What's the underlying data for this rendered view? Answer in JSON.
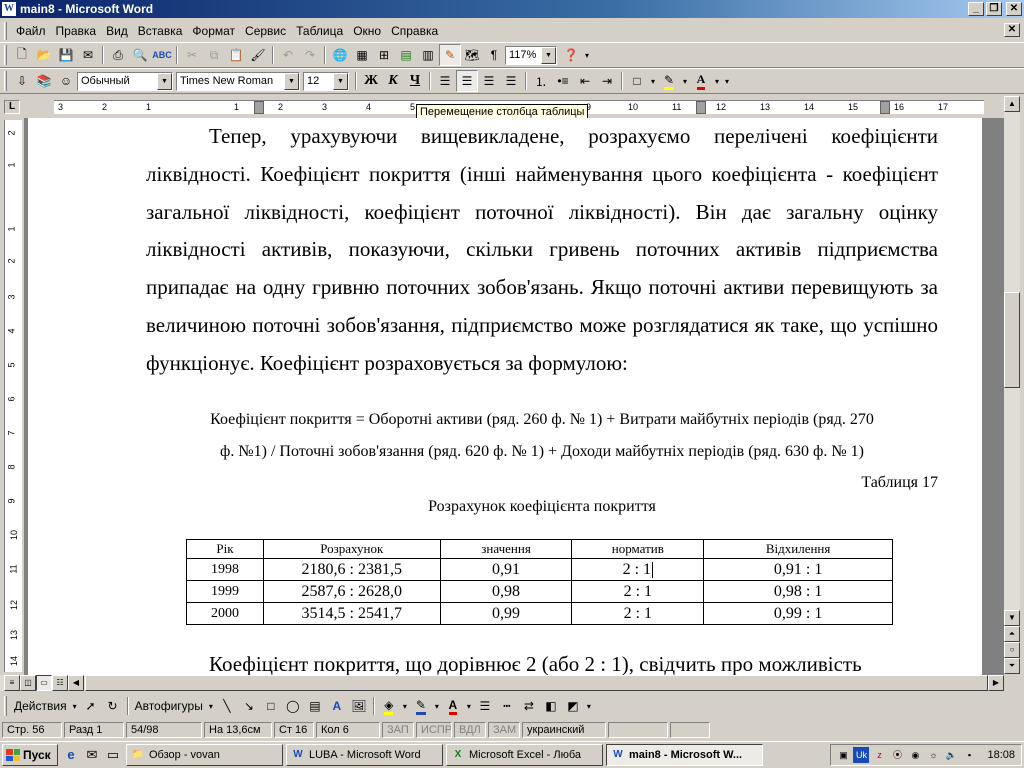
{
  "window": {
    "title": "main8 - Microsoft Word",
    "icon": "word-document-icon",
    "controls": [
      "minimize-icon",
      "restore-icon",
      "close-icon"
    ]
  },
  "menu": {
    "items": [
      "Файл",
      "Правка",
      "Вид",
      "Вставка",
      "Формат",
      "Сервис",
      "Таблица",
      "Окно",
      "Справка"
    ]
  },
  "toolbar_standard": {
    "zoom": "117%"
  },
  "toolbar_format": {
    "style": "Обычный",
    "font": "Times New Roman",
    "size": "12",
    "bold_label": "Ж",
    "italic_label": "К",
    "underline_label": "Ч"
  },
  "ruler": {
    "numbers": [
      "3",
      "2",
      "1",
      "1",
      "2",
      "3",
      "4",
      "5",
      "9",
      "10",
      "11",
      "12",
      "13",
      "14",
      "15",
      "16",
      "17"
    ],
    "vertical_numbers": [
      "2",
      "1",
      "1",
      "2",
      "3",
      "4",
      "5",
      "6",
      "7",
      "8",
      "9",
      "10",
      "11",
      "12",
      "13",
      "14"
    ]
  },
  "tooltip": "Перемещение столбца таблицы",
  "document": {
    "paragraph1": "Тепер, урахувуючи вищевикладене, розрахуємо перелічені коефіцієнти ліквідності. Коефіцієнт покриття (інші найменування цього коефіцієнта - коефіцієнт загальної ліквідності, коефіцієнт поточної ліквідності). Він дає загальну оцінку ліквідності активів, показуючи, скільки гривень поточних активів підприємства припадає на одну гривню поточних зобов'язань. Якщо поточні активи перевищують за величиною поточні зобов'язання, підприємство може розглядатися як таке, що успішно функціонує. Коефіцієнт розраховується за формулою:",
    "formula_line1": "Коефіцієнт покриття = Оборотні активи (ряд. 260 ф. № 1) + Витрати майбутніх періодів (ряд. 270",
    "formula_line2": "ф. №1) / Поточні зобов'язання (ряд. 620 ф. № 1) + Доходи майбутніх періодів (ряд. 630 ф. № 1)",
    "table_number": "Таблиця 17",
    "table_title": "Розрахунок коефіцієнта покриття",
    "table": {
      "headers": [
        "Рік",
        "Розрахунок",
        "значення",
        "норматив",
        "Відхилення"
      ],
      "rows": [
        [
          "1998",
          "2180,6 : 2381,5",
          "0,91",
          "2 : 1",
          "0,91 : 1"
        ],
        [
          "1999",
          "2587,6 : 2628,0",
          "0,98",
          "2 : 1",
          "0,98 : 1"
        ],
        [
          "2000",
          "3514,5 : 2541,7",
          "0,99",
          "2 : 1",
          "0,99 : 1"
        ]
      ]
    },
    "paragraph2": "Коефіцієнт покриття, що дорівнює 2 (або 2 : 1), свідчить про можливість"
  },
  "drawing_toolbar": {
    "actions_label": "Действия",
    "autoshapes_label": "Автофигуры"
  },
  "status": {
    "page": "Стр. 56",
    "section": "Разд 1",
    "pages": "54/98",
    "position": "На 13,6см",
    "line": "Ст 16",
    "column": "Кол 6",
    "rec": "ЗАП",
    "trk": "ИСПР",
    "ext": "ВДЛ",
    "ovr": "ЗАМ",
    "language": "украинский"
  },
  "taskbar": {
    "start_label": "Пуск",
    "tasks": [
      {
        "label": "Обзор - vovan",
        "icon": "folder-icon",
        "active": false
      },
      {
        "label": "LUBA - Microsoft Word",
        "icon": "word-icon",
        "active": false
      },
      {
        "label": "Microsoft Excel - Люба",
        "icon": "excel-icon",
        "active": false
      },
      {
        "label": "main8 - Microsoft W...",
        "icon": "word-icon",
        "active": true
      }
    ],
    "tray_lang": "Uk",
    "clock": "18:08"
  }
}
